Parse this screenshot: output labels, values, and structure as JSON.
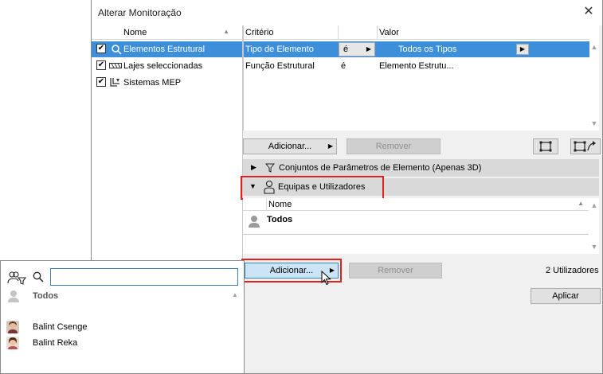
{
  "dialog": {
    "title": "Alterar Monitoração",
    "close_symbol": "✕"
  },
  "left_list": {
    "header": "Nome",
    "items": [
      {
        "label": "Elementos Estrutural",
        "checked": true,
        "selected": true,
        "icon": "structural-icon"
      },
      {
        "label": "Lajes seleccionadas",
        "checked": true,
        "selected": false,
        "icon": "slab-icon"
      },
      {
        "label": "Sistemas MEP",
        "checked": true,
        "selected": false,
        "icon": "mep-icon"
      }
    ]
  },
  "criteria": {
    "headers": {
      "criterio": "Critério",
      "valor": "Valor"
    },
    "rows": [
      {
        "criterio": "Tipo de Elemento",
        "op": "é",
        "valor": "Todos os Tipos",
        "selected": true
      },
      {
        "criterio": "Função Estrutural",
        "op": "é",
        "valor": "Elemento Estrutu...",
        "selected": false
      }
    ]
  },
  "criteria_buttons": {
    "add": "Adicionar...",
    "remove": "Remover"
  },
  "sections": {
    "params": "Conjuntos de Parâmetros de Elemento (Apenas 3D)",
    "teams": "Equipas e Utilizadores"
  },
  "users_table": {
    "header": "Nome",
    "rows": [
      {
        "label": "Todos",
        "bold": true
      }
    ]
  },
  "users_buttons": {
    "add": "Adicionar...",
    "remove": "Remover",
    "count": "2 Utilizadores"
  },
  "apply_button": "Aplicar",
  "popup": {
    "search_placeholder": "",
    "all_label": "Todos",
    "users": [
      "Balint Csenge",
      "Balint Reka"
    ]
  },
  "colors": {
    "selection": "#3d8fd9",
    "highlight_border": "#e0201c",
    "button_active": "#cce4f7"
  }
}
